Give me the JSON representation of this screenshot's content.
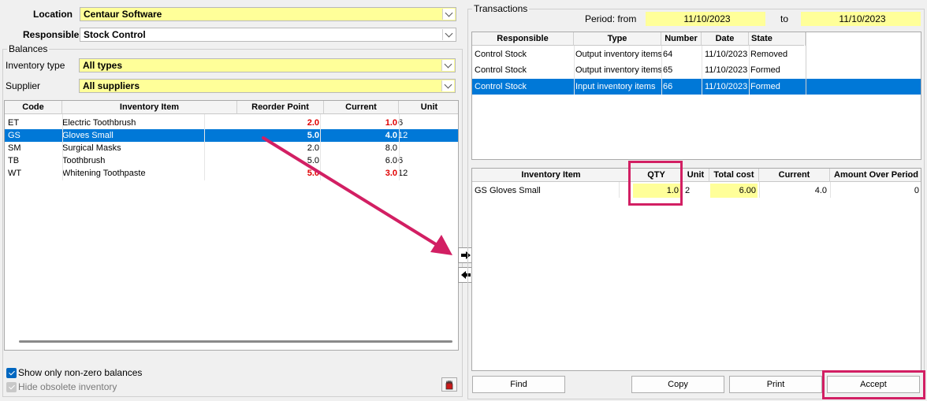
{
  "filters": {
    "location_label": "Location",
    "location_value": "Centaur Software",
    "responsible_label": "Responsible",
    "responsible_value": "Stock  Control"
  },
  "balances": {
    "group_label": "Balances",
    "inventory_type_label": "Inventory type",
    "inventory_type_value": "All types",
    "supplier_label": "Supplier",
    "supplier_value": "All suppliers",
    "columns": [
      "Code",
      "Inventory Item",
      "Reorder Point",
      "Current",
      "Unit"
    ],
    "rows": [
      {
        "code": "ET",
        "item": "Electric Toothbrush",
        "reorder": "2.0",
        "current": "1.0",
        "unit": "6"
      },
      {
        "code": "GS",
        "item": "Gloves Small",
        "reorder": "5.0",
        "current": "4.0",
        "unit": "12"
      },
      {
        "code": "SM",
        "item": "Surgical Masks",
        "reorder": "2.0",
        "current": "8.0",
        "unit": ""
      },
      {
        "code": "TB",
        "item": "Toothbrush",
        "reorder": "5.0",
        "current": "6.0",
        "unit": "6"
      },
      {
        "code": "WT",
        "item": "Whitening Toothpaste",
        "reorder": "5.0",
        "current": "3.0",
        "unit": "12"
      }
    ],
    "show_nonzero_label": "Show only non-zero balances",
    "hide_obsolete_label": "Hide obsolete inventory"
  },
  "transactions": {
    "group_label": "Transactions",
    "period_from_label": "Period: from",
    "period_from": "11/10/2023",
    "period_to_label": "to",
    "period_to": "11/10/2023",
    "columns": [
      "Responsible",
      "Type",
      "Number",
      "Date",
      "State"
    ],
    "rows": [
      {
        "responsible": "Control  Stock",
        "type": "Output inventory items",
        "number": "64",
        "date": "11/10/2023",
        "state": "Removed"
      },
      {
        "responsible": "Control  Stock",
        "type": "Output inventory items",
        "number": "65",
        "date": "11/10/2023",
        "state": "Formed"
      },
      {
        "responsible": "Control  Stock",
        "type": "Input inventory items",
        "number": "66",
        "date": "11/10/2023",
        "state": "Formed"
      }
    ]
  },
  "details": {
    "columns": [
      "Inventory Item",
      "QTY",
      "Unit",
      "Total cost",
      "Current",
      "Amount Over Period"
    ],
    "rows": [
      {
        "item": "GS Gloves Small",
        "qty": "1.0",
        "unit": "2",
        "total_cost": "6.00",
        "current": "4.0",
        "amount": "0"
      }
    ]
  },
  "buttons": {
    "find": "Find",
    "copy": "Copy",
    "print": "Print",
    "accept": "Accept",
    "move_right": "🡆",
    "move_left": "🡄"
  },
  "colors": {
    "highlight_pink": "#d21f63",
    "selection_blue": "#0078d7",
    "field_yellow": "#ffff99",
    "alert_red": "#e00000"
  }
}
